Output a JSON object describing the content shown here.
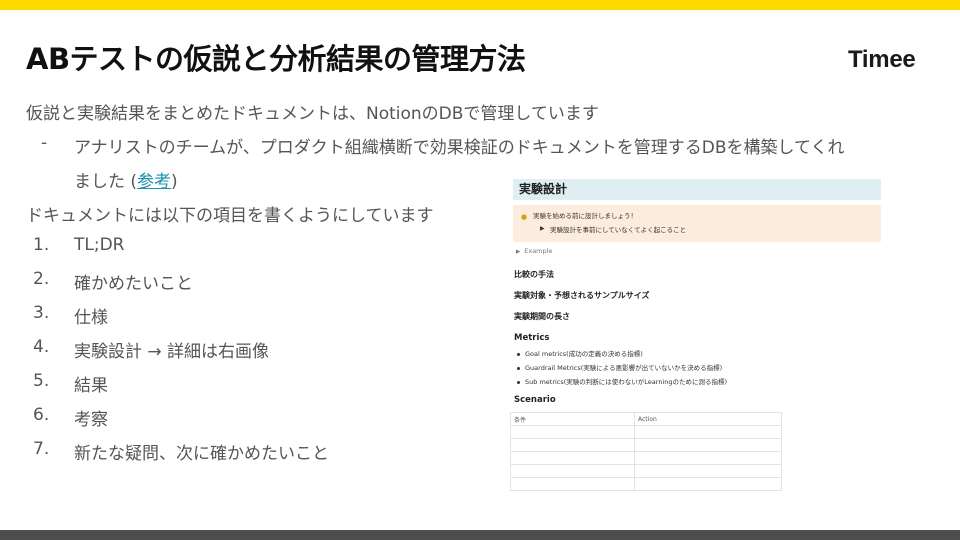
{
  "slide": {
    "title": "ABテストの仮説と分析結果の管理方法",
    "logo": "Timee",
    "intro": "仮説と実験結果をまとめたドキュメントは、NotionのDBで管理しています",
    "dash": "-",
    "sub_line1": "アナリストのチームが、プロダクト組織横断で効果検証のドキュメントを管理するDBを構築してくれ",
    "sub_line2_prefix": "ました (",
    "sub_link": "参考",
    "sub_line2_suffix": ")",
    "intro2": "ドキュメントには以下の項目を書くようにしています",
    "items": [
      {
        "num": "1.",
        "text": "TL;DR"
      },
      {
        "num": "2.",
        "text": "確かめたいこと"
      },
      {
        "num": "3.",
        "text": "仕様"
      },
      {
        "num": "4.",
        "text": "実験設計 → 詳細は右画像"
      },
      {
        "num": "5.",
        "text": "結果"
      },
      {
        "num": "6.",
        "text": "考察"
      },
      {
        "num": "7.",
        "text": "新たな疑問、次に確かめたいこと"
      }
    ]
  },
  "notion": {
    "title": "実験設計",
    "callout_line1": "実験を始める前に設計しましょう！",
    "callout_line2": "実験設計を事前にしていなくてよく起こること",
    "toggle_example": "Example",
    "heading_compare": "比較の手法",
    "heading_target": "実験対象・予想されるサンプルサイズ",
    "heading_period": "実験期間の長さ",
    "heading_metrics": "Metrics",
    "metrics": [
      "Goal metrics(成功の定義の決める指標)",
      "Guardrail Metrics(実験による悪影響が出ていないかを決める指標)",
      "Sub metrics(実験の判断には使わないがLearningのために測る指標)"
    ],
    "heading_scenario": "Scenario",
    "table_headers": [
      "条件",
      "Action"
    ]
  },
  "colors": {
    "accent_top": "#ffd900",
    "bottom_bar": "#4d4d4d",
    "link": "#1a8fb0",
    "notion_title_bg": "#dfeef3",
    "callout_bg": "#fbecdd"
  }
}
